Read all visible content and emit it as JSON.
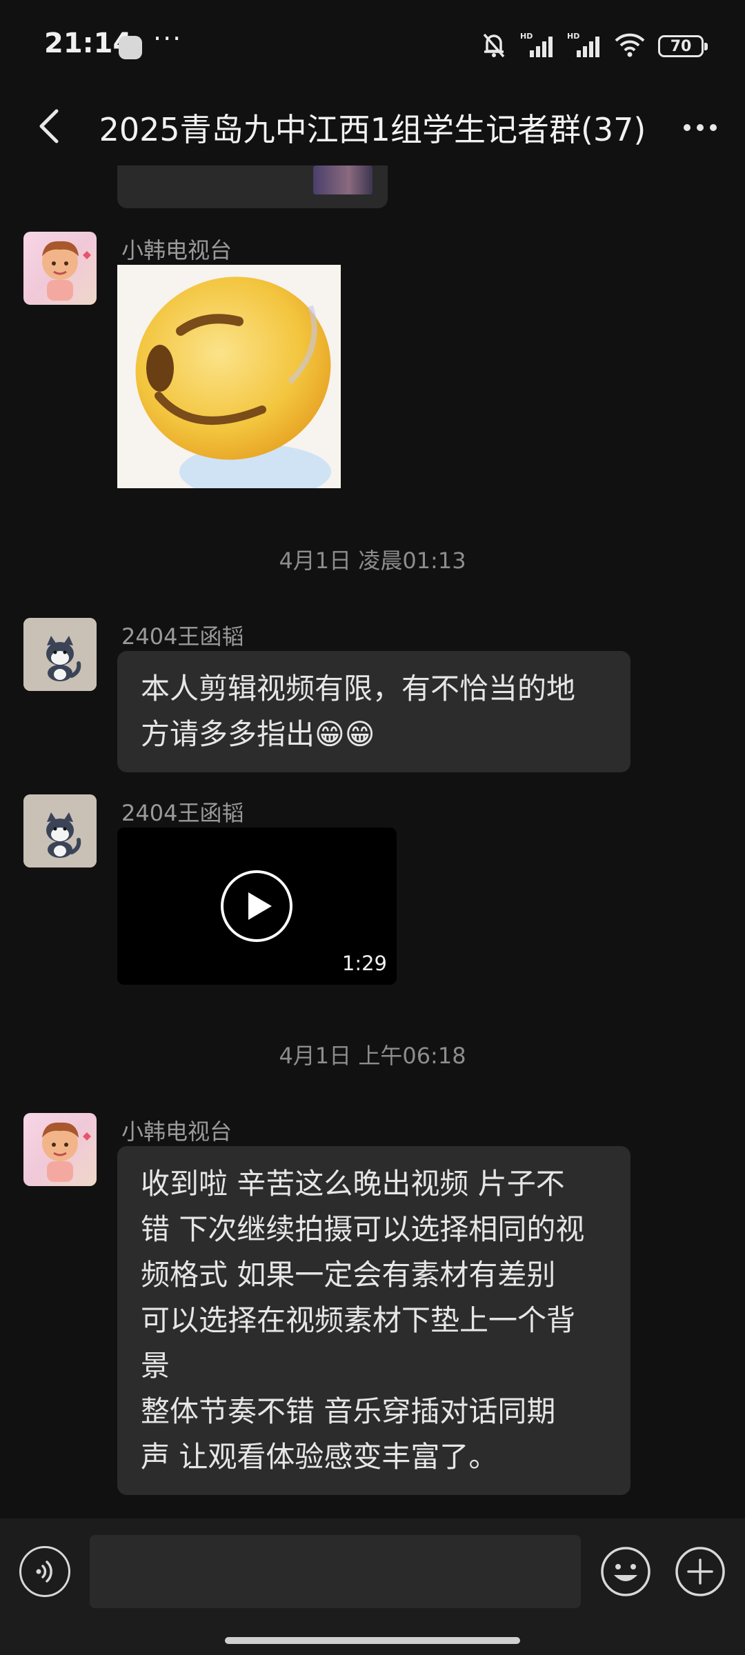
{
  "status_bar": {
    "time": "21:14",
    "dots": "···",
    "battery": "70",
    "icons": [
      "wechat-app-icon",
      "bell-muted-icon",
      "signal-hd-icon",
      "signal-hd-icon",
      "wifi-icon",
      "battery-icon"
    ]
  },
  "header": {
    "title": "2025青岛九中江西1组学生记者群(37)",
    "back_icon": "chevron-left-icon",
    "more_icon": "more-horizontal-icon"
  },
  "messages": [
    {
      "type": "image-partial",
      "note_icon": "photo-thumbnail"
    },
    {
      "type": "sticker",
      "sender": "小韩电视台",
      "sticker_icon": "grinning-face-sticker"
    },
    {
      "type": "timestamp",
      "text": "4月1日 凌晨01:13"
    },
    {
      "type": "text",
      "sender": "2404王函韬",
      "lines": [
        "本人剪辑视频有限，有不恰当的地",
        "方请多多指出😁😁"
      ]
    },
    {
      "type": "video",
      "sender": "2404王函韬",
      "duration": "1:29"
    },
    {
      "type": "timestamp",
      "text": "4月1日 上午06:18"
    },
    {
      "type": "text",
      "sender": "小韩电视台",
      "lines": [
        "收到啦 辛苦这么晚出视频 片子不",
        "错 下次继续拍摄可以选择相同的视",
        "频格式 如果一定会有素材有差别",
        "可以选择在视频素材下垫上一个背",
        "景",
        "整体节奏不错 音乐穿插对话同期",
        "声 让观看体验感变丰富了。"
      ]
    }
  ],
  "input_bar": {
    "placeholder": "",
    "voice_icon": "voice-icon",
    "emoji_icon": "emoji-icon",
    "plus_icon": "plus-icon"
  },
  "colors": {
    "background": "#111111",
    "bubble": "#2c2c2c",
    "text": "#e6e6e6",
    "muted": "#9a9a9a"
  }
}
